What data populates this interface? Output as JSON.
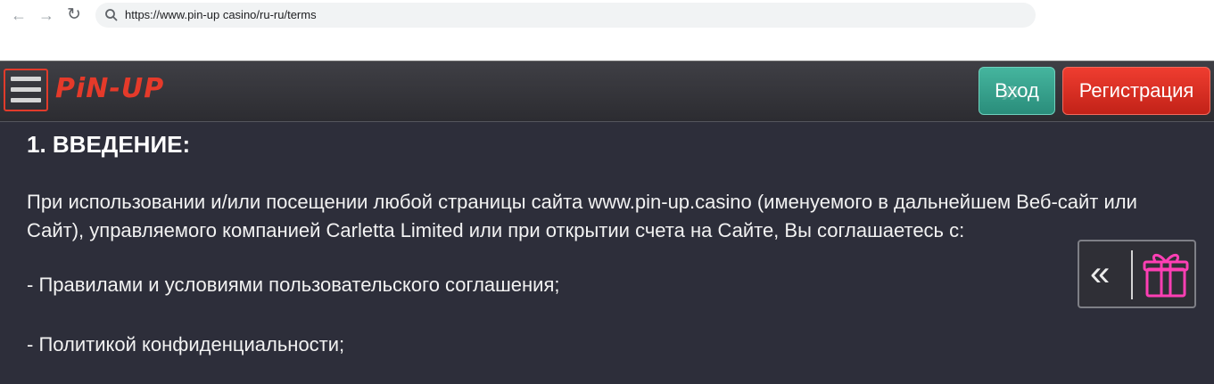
{
  "browser": {
    "url": "https://www.pin-up casino/ru-ru/terms",
    "back_icon": "←",
    "forward_icon": "→",
    "reload_icon": "↻"
  },
  "header": {
    "logo_text": "PiN-UP",
    "login_label": "Вход",
    "register_label": "Регистрация",
    "colors": {
      "accent_red": "#e53a2a",
      "login_green": "#2a8d7b",
      "background": "#2d2e3a"
    }
  },
  "content": {
    "heading": "1. ВВЕДЕНИЕ:",
    "paragraph": "При использовании и/или посещении любой страницы сайта www.pin-up.casino (именуемого в дальнейшем Веб-сайт или Сайт), управляемого компанией Carletta Limited или при открытии счета на Сайте, Вы соглашаетесь с:",
    "list_item_1": "- Правилами и условиями пользовательского соглашения;",
    "list_item_2": "- Политикой конфиденциальности;"
  },
  "widget": {
    "collapse_icon": "«",
    "gift_icon": "gift-icon"
  }
}
